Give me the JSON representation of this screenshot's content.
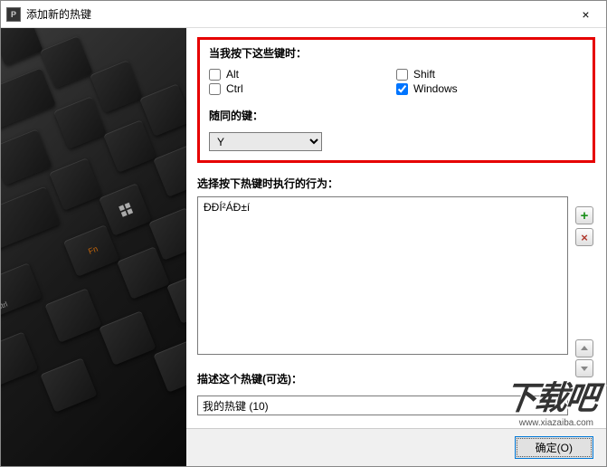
{
  "titlebar": {
    "title": "添加新的热键",
    "close_icon": "×"
  },
  "keyboard": {
    "fn": "Fn",
    "ctrl": "Ctrl"
  },
  "modifiers": {
    "label": "当我按下这些键时：",
    "alt": {
      "label": "Alt",
      "checked": false
    },
    "ctrl": {
      "label": "Ctrl",
      "checked": false
    },
    "shift": {
      "label": "Shift",
      "checked": false
    },
    "windows": {
      "label": "Windows",
      "checked": true
    }
  },
  "withkey": {
    "label": "随同的键：",
    "value": "Y"
  },
  "action": {
    "label": "选择按下热键时执行的行为：",
    "text": "ÐÐÍ²ÁÐ±í"
  },
  "describe": {
    "label": "描述这个热键(可选)：",
    "value": "我的热键 (10)"
  },
  "footer": {
    "ok": "确定(O)"
  },
  "watermark": {
    "big": "下载吧",
    "url": "www.xiazaiba.com"
  },
  "icons": {
    "add": "+",
    "del": "×"
  }
}
